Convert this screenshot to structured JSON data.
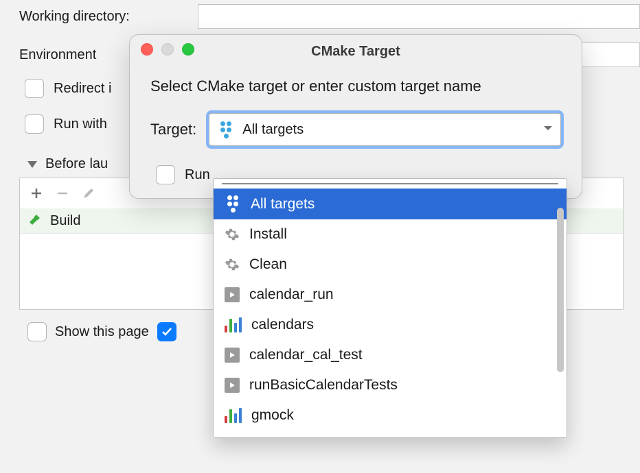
{
  "form": {
    "working_directory_label": "Working directory:",
    "environment_label": "Environment",
    "redirect_label": "Redirect i",
    "run_with_label": "Run with"
  },
  "before_launch": {
    "title": "Before lau",
    "task_label": "Build",
    "show_page_label": "Show this page"
  },
  "modal": {
    "title": "CMake Target",
    "prompt": "Select CMake target or enter custom target name",
    "target_label": "Target:",
    "combo_value": "All targets",
    "run_label": "Run"
  },
  "dropdown": {
    "items": [
      {
        "label": "All targets",
        "icon": "all-targets",
        "selected": true
      },
      {
        "label": "Install",
        "icon": "gear",
        "selected": false
      },
      {
        "label": "Clean",
        "icon": "gear",
        "selected": false
      },
      {
        "label": "calendar_run",
        "icon": "exec",
        "selected": false
      },
      {
        "label": "calendars",
        "icon": "bars",
        "selected": false
      },
      {
        "label": "calendar_cal_test",
        "icon": "exec",
        "selected": false
      },
      {
        "label": "runBasicCalendarTests",
        "icon": "exec",
        "selected": false
      },
      {
        "label": "gmock",
        "icon": "bars",
        "selected": false
      }
    ]
  }
}
